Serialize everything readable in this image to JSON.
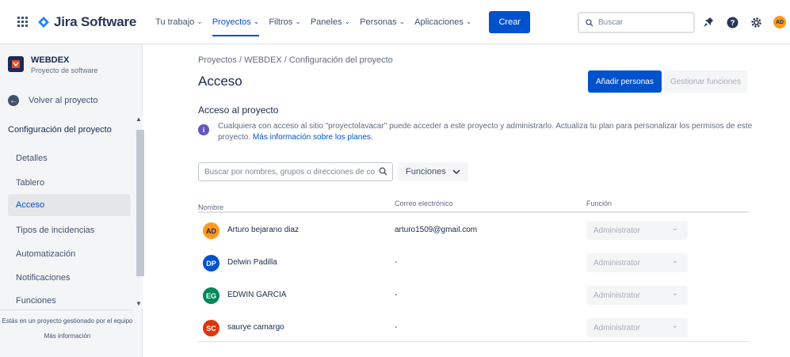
{
  "topbar": {
    "brand": "Jira Software",
    "nav": [
      {
        "label": "Tu trabajo",
        "active": false
      },
      {
        "label": "Proyectos",
        "active": true
      },
      {
        "label": "Filtros",
        "active": false
      },
      {
        "label": "Paneles",
        "active": false
      },
      {
        "label": "Personas",
        "active": false
      },
      {
        "label": "Aplicaciones",
        "active": false
      }
    ],
    "create_label": "Crear",
    "search_placeholder": "Buscar",
    "avatar_initials": "AD",
    "icons": [
      "apps-grid-icon",
      "jira-logo-icon",
      "notifications-icon",
      "help-icon",
      "settings-icon"
    ]
  },
  "sidebar": {
    "project_name": "WEBDEX",
    "project_type": "Proyecto de software",
    "back_label": "Volver al proyecto",
    "section_title": "Configuración del proyecto",
    "items": [
      {
        "label": "Detalles"
      },
      {
        "label": "Tablero"
      },
      {
        "label": "Acceso"
      },
      {
        "label": "Tipos de incidencias"
      },
      {
        "label": "Automatización"
      },
      {
        "label": "Notificaciones"
      },
      {
        "label": "Funciones"
      }
    ],
    "selected": "Acceso",
    "footer_text": "Estás en un proyecto gestionado por el equipo",
    "footer_link": "Más información"
  },
  "main": {
    "breadcrumb": "Proyectos  /  WEBDEX  /  Configuración del proyecto",
    "title": "Acceso",
    "add_people_label": "Añadir personas",
    "manage_roles_label": "Gestionar funciones",
    "section_title": "Acceso al proyecto",
    "info_text": "Cualquiera con acceso al sitio \"proyectolavacar\" puede acceder a este proyecto y administrarlo. Actualiza tu plan para personalizar los permisos de este proyecto.",
    "info_link": "Más información sobre los planes.",
    "search_placeholder": "Buscar por nombres, grupos o direcciones de correo electrónico",
    "roles_filter_label": "Funciones",
    "columns": {
      "name": "Nombre",
      "email": "Correo electrónico",
      "role": "Función"
    },
    "sort_indicator": "↑",
    "users": [
      {
        "initials": "AD",
        "name": "Arturo bejarano diaz",
        "email": "arturo1509@gmail.com",
        "role": "Administrator",
        "color": "#FF991F"
      },
      {
        "initials": "DP",
        "name": "Delwin Padilla",
        "email": "-",
        "role": "Administrator",
        "color": "#0052CC"
      },
      {
        "initials": "EG",
        "name": "EDWIN GARCIA",
        "email": "-",
        "role": "Administrator",
        "color": "#00875A"
      },
      {
        "initials": "SC",
        "name": "saurye camargo",
        "email": "-",
        "role": "Administrator",
        "color": "#DE350B"
      }
    ]
  }
}
